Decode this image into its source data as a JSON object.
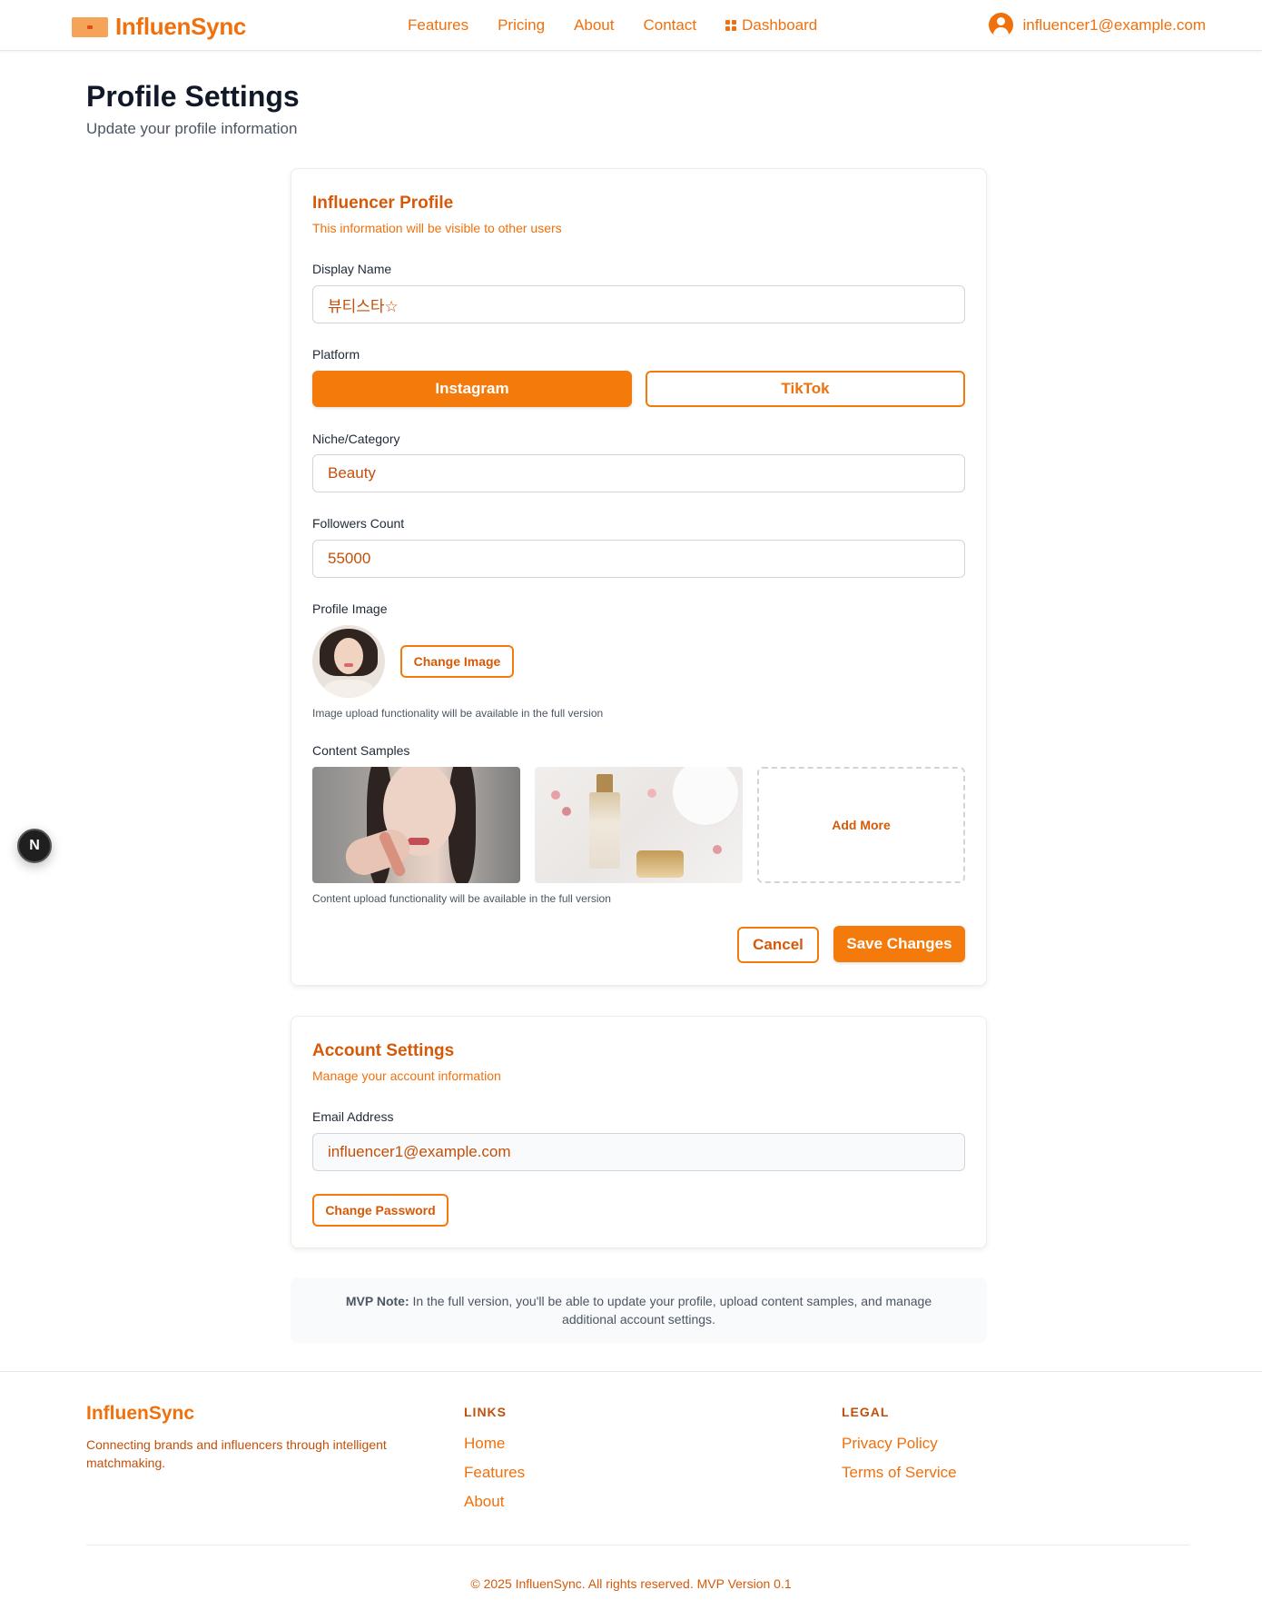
{
  "nav": {
    "brand": "InfluenSync",
    "links": [
      "Features",
      "Pricing",
      "About",
      "Contact"
    ],
    "dashboard": "Dashboard",
    "user_email": "influencer1@example.com"
  },
  "header": {
    "title": "Profile Settings",
    "subtitle": "Update your profile information"
  },
  "influencer_profile": {
    "title": "Influencer Profile",
    "description": "This information will be visible to other users",
    "display_name_label": "Display Name",
    "display_name_value": "뷰티스타☆",
    "platform_label": "Platform",
    "platform_options": [
      "Instagram",
      "TikTok"
    ],
    "selected_platform": "Instagram",
    "niche_label": "Niche/Category",
    "niche_value": "Beauty",
    "followers_label": "Followers Count",
    "followers_value": "55000",
    "profile_image_label": "Profile Image",
    "change_image_label": "Change Image",
    "image_helper": "Image upload functionality will be available in the full version",
    "content_samples_label": "Content Samples",
    "add_more_label": "Add More",
    "content_helper": "Content upload functionality will be available in the full version",
    "cancel_label": "Cancel",
    "save_label": "Save Changes"
  },
  "account_settings": {
    "title": "Account Settings",
    "description": "Manage your account information",
    "email_label": "Email Address",
    "email_value": "influencer1@example.com",
    "change_password_label": "Change Password"
  },
  "mvp_note": {
    "label": "MVP Note:",
    "text": "In the full version, you'll be able to update your profile, upload content samples, and manage additional account settings."
  },
  "next_badge": "N",
  "footer": {
    "brand": "InfluenSync",
    "tagline": "Connecting brands and influencers through intelligent matchmaking.",
    "links_heading": "LINKS",
    "links": [
      "Home",
      "Features",
      "About"
    ],
    "legal_heading": "LEGAL",
    "legal": [
      "Privacy Policy",
      "Terms of Service"
    ],
    "copyright": "© 2025 InfluenSync. All rights reserved. MVP Version 0.1"
  },
  "colors": {
    "accent": "#f47a0b",
    "accent_dark": "#d45a09",
    "text_dark": "#111827",
    "muted": "#4b5563"
  }
}
